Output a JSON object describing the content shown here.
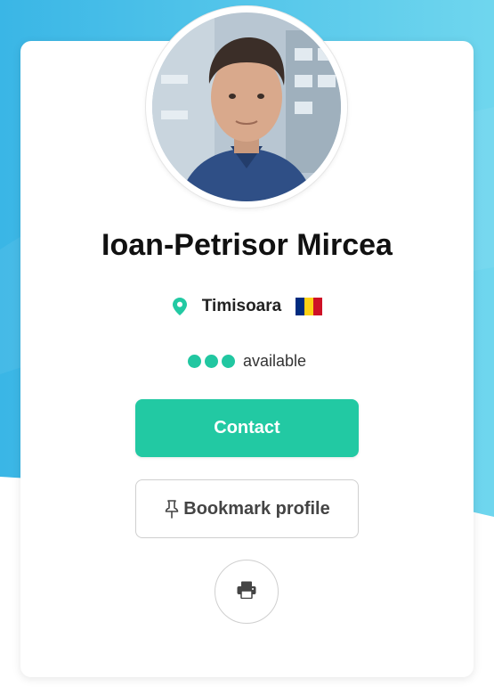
{
  "profile": {
    "name": "Ioan-Petrisor Mircea",
    "city": "Timisoara",
    "availability_status": "available",
    "availability_level": 3
  },
  "actions": {
    "contact_label": "Contact",
    "bookmark_label": "Bookmark profile"
  },
  "icons": {
    "location": "location-pin-icon",
    "flag": "romania-flag-icon",
    "bookmark": "pushpin-icon",
    "print": "printer-icon"
  },
  "colors": {
    "accent": "#22c9a3",
    "background_gradient_start": "#3ab6e6",
    "background_gradient_end": "#6fd6ee",
    "flag_blue": "#002b7f",
    "flag_yellow": "#fcd116",
    "flag_red": "#ce1126"
  }
}
